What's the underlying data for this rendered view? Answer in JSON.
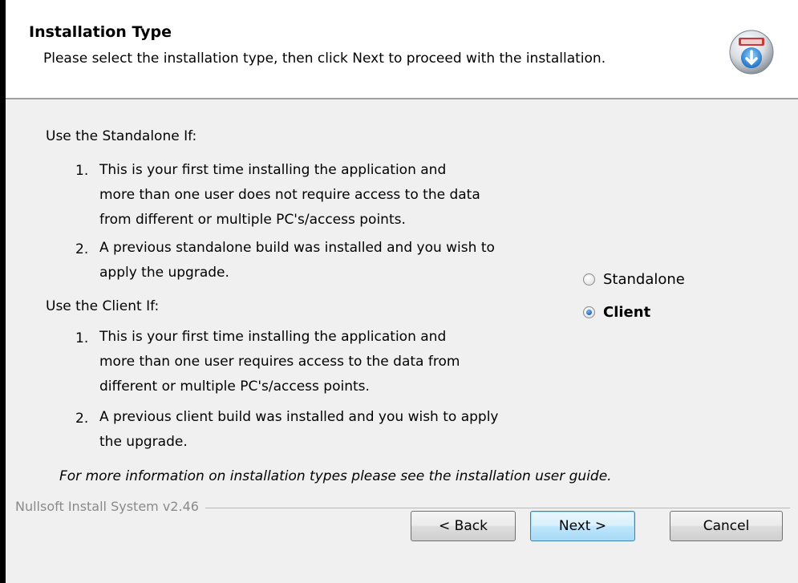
{
  "header": {
    "title": "Installation Type",
    "subtitle": "Please select the installation type, then click Next to proceed with the installation.",
    "icon": "installer-globe-icon"
  },
  "standalone_section": {
    "heading": "Use the Standalone If:",
    "items": [
      {
        "num": "1.",
        "lines": [
          "This is your first time installing the application and",
          "more than one user does not require access to the data",
          "from different or multiple PC's/access points."
        ]
      },
      {
        "num": "2.",
        "lines": [
          "A previous standalone build was installed and you wish to",
          "apply the upgrade."
        ]
      }
    ]
  },
  "client_section": {
    "heading": "Use the Client If:",
    "items": [
      {
        "num": "1.",
        "lines": [
          "This is your first time installing the application and",
          "more than one user requires access to the data from",
          "different or multiple PC's/access points."
        ]
      },
      {
        "num": "2.",
        "lines": [
          "A previous client build was installed and you wish to apply",
          "the upgrade."
        ]
      }
    ]
  },
  "options": {
    "standalone_label": "Standalone",
    "client_label": "Client",
    "selected": "Client"
  },
  "info_note": "For more information on installation types please see the installation user guide.",
  "branding": "Nullsoft Install System v2.46",
  "buttons": {
    "back": "< Back",
    "next": "Next >",
    "cancel": "Cancel"
  },
  "colors": {
    "window_bg": "#f0f0f0",
    "header_bg": "#ffffff",
    "branding_text": "#8a8a8a",
    "default_button_border": "#3c7fb1"
  }
}
